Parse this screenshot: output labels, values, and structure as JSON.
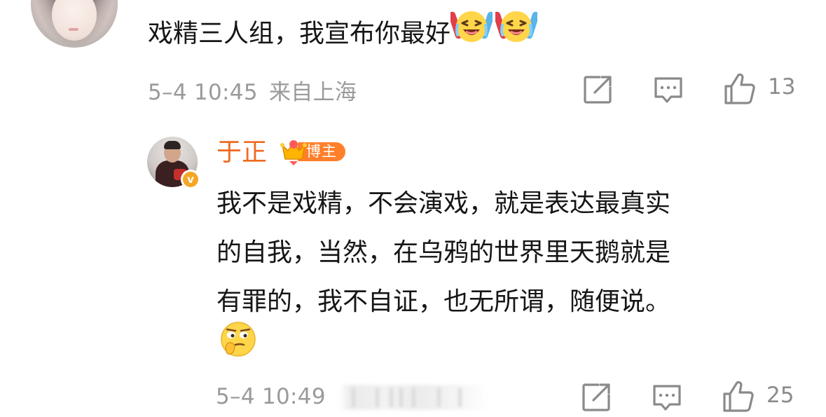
{
  "top_comment": {
    "text": "戏精三人组，我宣布你最好",
    "emojis": [
      "laugh-cry-emoji",
      "laugh-cry-emoji"
    ],
    "timestamp": "5–4 10:45",
    "location": "来自上海",
    "like_count": "13",
    "icons": [
      "share-icon",
      "comment-icon",
      "like-icon"
    ]
  },
  "reply": {
    "author": "于正",
    "author_badge": "博主",
    "author_name_color": "#ef6a21",
    "badge_color": "#ff7f2a",
    "verify_badge_color": "#f5a623",
    "verify_mark": "v",
    "lines": [
      "我不是戏精，不会演戏，就是表达最真实",
      "的自我，当然，在乌鸦的世界里天鹅就是",
      "有罪的，我不自证，也无所谓，随便说。"
    ],
    "emoji": "thinking-smirk-emoji",
    "timestamp": "5–4 10:49",
    "like_count": "25",
    "icons": [
      "share-icon",
      "comment-icon",
      "like-icon"
    ]
  },
  "colors": {
    "meta_text": "#9a9a9a",
    "icon": "#8a8a8a",
    "body_text": "#161616"
  }
}
